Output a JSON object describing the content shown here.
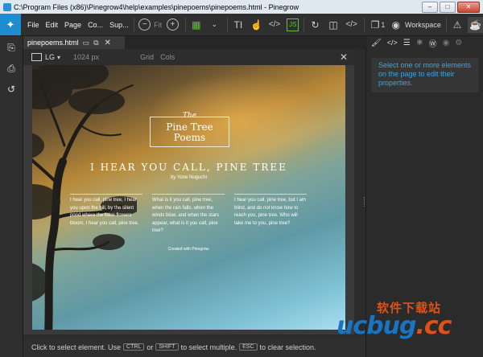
{
  "window": {
    "title": "C:\\Program Files (x86)\\Pinegrow4\\help\\examples\\pinepoems\\pinepoems.html - Pinegrow",
    "minimize": "–",
    "maximize": "□",
    "close": "✕"
  },
  "menu": {
    "items": [
      "File",
      "Edit",
      "Page",
      "Co...",
      "Sup..."
    ],
    "fit_label": "Fit",
    "count_label": "1",
    "workspace_label": "Workspace",
    "icon_js": "JS"
  },
  "tab": {
    "name": "pinepoems.html"
  },
  "canvas_bar": {
    "device": "LG",
    "width": "1024 px",
    "grid": "Grid",
    "cols": "Cols"
  },
  "page_content": {
    "logo_the": "The",
    "logo_line1": "Pine Tree",
    "logo_line2": "Poems",
    "title": "I HEAR YOU CALL, PINE TREE",
    "byline": "by Yone Noguchi",
    "columns": [
      "I hear you call, pine tree, I hear you upon the hill, by the silent pond where the lotus flowers bloom, I hear you call, pine tree.",
      "What is it you call, pine tree, when the rain falls, when the winds blow, and when the stars appear, what is it you call, pine tree?",
      "I hear you call, pine tree, but I am blind, and do not know how to reach you, pine tree. Who will take me to you, pine tree?"
    ],
    "credit": "Created with Pinegrow."
  },
  "right_panel": {
    "message": "Select one or more elements on the page to edit their properties."
  },
  "status": {
    "t1": "Click to select element. Use",
    "k1": "CTRL",
    "t2": "or",
    "k2": "SHIFT",
    "t3": "to select multiple.",
    "k3": "ESC",
    "t4": "to clear selection."
  },
  "watermark": {
    "cn": "软件下载站",
    "main": "ucbug",
    "suffix": ".cc"
  },
  "colors": {
    "accent_blue": "#1f8ccf",
    "message_blue": "#38a7e0",
    "js_green": "#5ec43a",
    "highlight_orange": "#f0a030"
  }
}
